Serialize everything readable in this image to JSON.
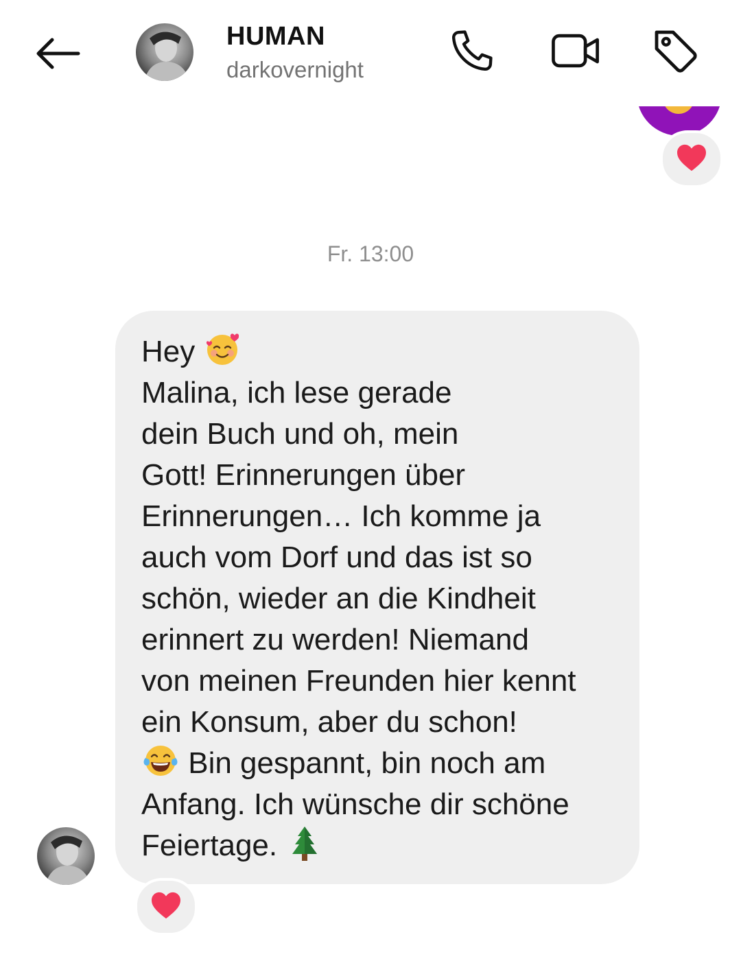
{
  "header": {
    "back_icon": "arrow-left-icon",
    "contact_name": "HUMAN",
    "contact_username": "darkovernight",
    "actions": [
      {
        "name": "phone-call",
        "icon": "phone-icon"
      },
      {
        "name": "video-call",
        "icon": "video-camera-icon"
      },
      {
        "name": "tag",
        "icon": "tag-icon"
      }
    ]
  },
  "thread": {
    "sent_message": {
      "bubble_color": "#9013b8",
      "reaction": "❤"
    },
    "timestamp": "Fr. 13:00",
    "received_message": {
      "lines": [
        {
          "text": "Hey ",
          "emoji_after": "smiling-face-with-hearts"
        },
        {
          "text": "Malina, ich lese gerade"
        },
        {
          "text": "dein Buch und oh, mein"
        },
        {
          "text": "Gott! Erinnerungen über"
        },
        {
          "text": "Erinnerungen… Ich komme ja"
        },
        {
          "text": "auch vom Dorf und das ist so"
        },
        {
          "text": "schön, wieder an die Kindheit"
        },
        {
          "text": "erinnert zu werden! Niemand"
        },
        {
          "text": "von meinen Freunden hier kennt"
        },
        {
          "text": "ein Konsum, aber du schon!"
        },
        {
          "text": " Bin gespannt, bin noch am",
          "emoji_before": "face-with-tears-of-joy"
        },
        {
          "text": "Anfang. Ich wünsche dir schöne"
        },
        {
          "text": "Feiertage. ",
          "emoji_after": "evergreen-tree"
        }
      ],
      "bubble_color": "#efefef",
      "reaction": "❤"
    }
  },
  "colors": {
    "heart": "#f2385a",
    "timestamp": "#8e8e8e",
    "username": "#737373",
    "sent_bubble": "#9013b8"
  }
}
